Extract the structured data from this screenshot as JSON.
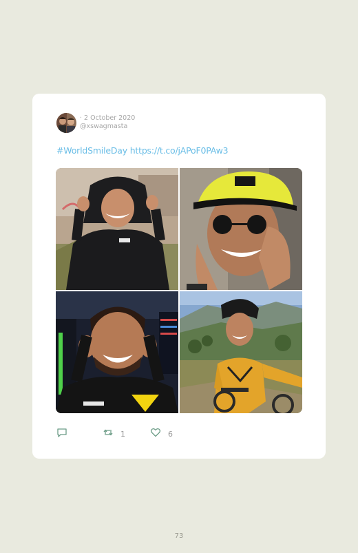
{
  "tweet": {
    "date": "· 2 October 2020",
    "handle": "@xswagmasta",
    "text": "#WorldSmileDay https://t.co/jAPoF0PAw3",
    "retweet_count": "1",
    "like_count": "6"
  },
  "icons": {
    "reply": "reply-icon",
    "retweet": "retweet-icon",
    "like": "heart-icon"
  },
  "colors": {
    "background": "#e9eadf",
    "card": "#ffffff",
    "link": "#69bde6",
    "meta_text": "#a7a7a7"
  },
  "page": {
    "number": "73"
  }
}
